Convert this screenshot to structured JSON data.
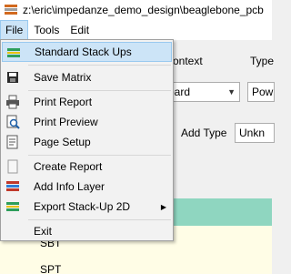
{
  "window": {
    "title": "z:\\eric\\impedanze_demo_design\\beaglebone_pcb"
  },
  "menubar": {
    "items": [
      {
        "label": "File"
      },
      {
        "label": "Tools"
      },
      {
        "label": "Edit"
      }
    ]
  },
  "background": {
    "context_label": "ontext",
    "type_label": "Type",
    "board_combo": "oard",
    "pow_combo": "Pow",
    "add_type_label": "Add Type",
    "unknown_combo": "Unkn",
    "row1": "SBT",
    "row2": "SPT"
  },
  "file_menu": {
    "items": [
      {
        "label": "Standard Stack Ups",
        "icon": "stackup-icon",
        "highlighted": true
      },
      {
        "label": "Save Matrix",
        "icon": "save-icon"
      },
      {
        "label": "Print Report",
        "icon": "print-icon"
      },
      {
        "label": "Print Preview",
        "icon": "print-preview-icon"
      },
      {
        "label": "Page Setup",
        "icon": "page-setup-icon"
      },
      {
        "label": "Create Report",
        "icon": "report-icon"
      },
      {
        "label": "Add Info Layer",
        "icon": "info-layer-icon"
      },
      {
        "label": "Export Stack-Up 2D",
        "icon": "export-stackup-icon",
        "submenu": true
      },
      {
        "label": "Exit",
        "icon": ""
      }
    ]
  },
  "colors": {
    "highlight": "#cce4f7",
    "grid_header": "#8fd6c0",
    "grid_background": "#fffde6"
  }
}
